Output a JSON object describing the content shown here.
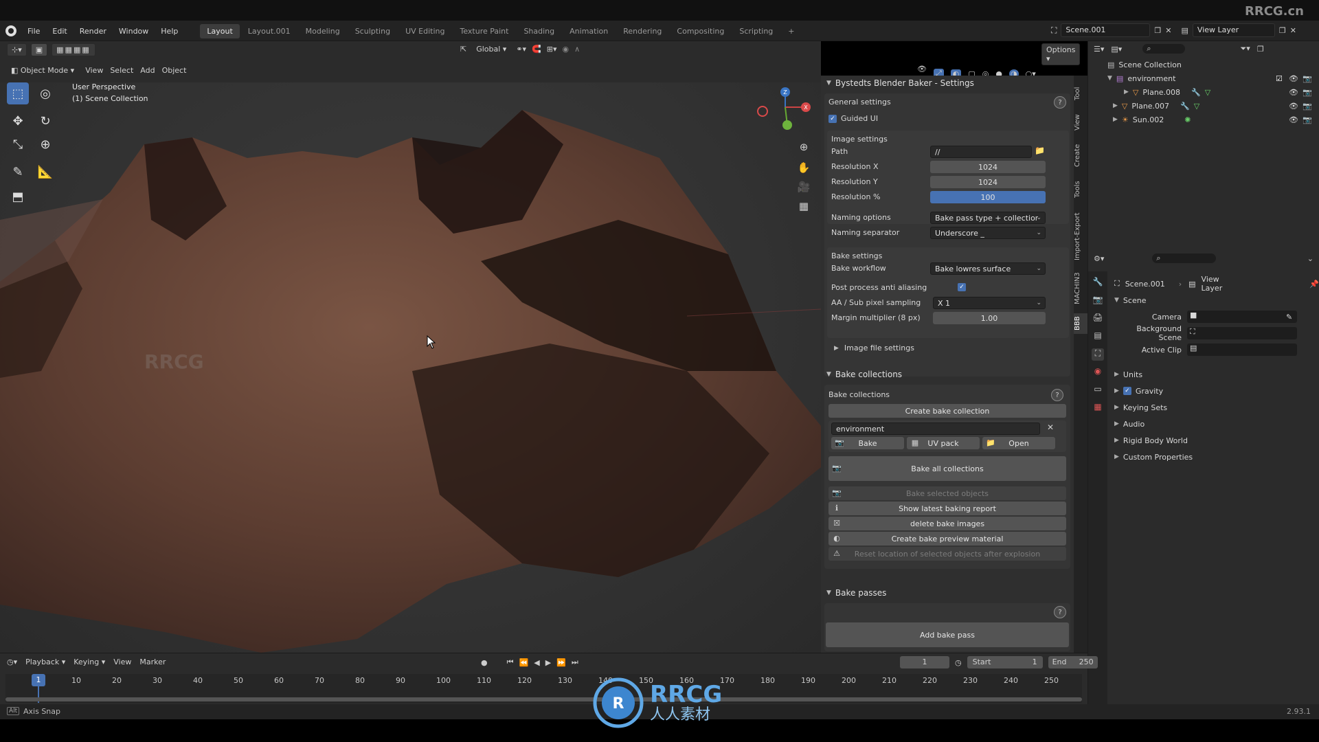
{
  "watermark": {
    "corner": "RRCG.cn",
    "center_title": "RRCG",
    "center_sub": "人人素材"
  },
  "menu": [
    "File",
    "Edit",
    "Render",
    "Window",
    "Help"
  ],
  "workspaces": [
    "Layout",
    "Layout.001",
    "Modeling",
    "Sculpting",
    "UV Editing",
    "Texture Paint",
    "Shading",
    "Animation",
    "Rendering",
    "Compositing",
    "Scripting"
  ],
  "workspace_add": "+",
  "scene_name": "Scene.001",
  "view_layer": "View Layer",
  "viewport_header": {
    "transform_orientation": "Global",
    "options": "Options",
    "mode": "Object Mode",
    "menus": [
      "View",
      "Select",
      "Add",
      "Object"
    ]
  },
  "viewport_overlay": {
    "perspective": "User Perspective",
    "collection": "(1) Scene Collection"
  },
  "side_tabs": [
    "Tool",
    "View",
    "Create",
    "Tools",
    "Import-Export",
    "MACHIN3",
    "BBB"
  ],
  "panel": {
    "title": "Bystedts Blender Baker - Settings",
    "general": "General settings",
    "guided_ui": "Guided UI",
    "image_settings": "Image settings",
    "path_label": "Path",
    "path_value": "//",
    "res_x_label": "Resolution X",
    "res_x": "1024",
    "res_y_label": "Resolution Y",
    "res_y": "1024",
    "res_pct_label": "Resolution %",
    "res_pct": "100",
    "naming_options_label": "Naming options",
    "naming_options": "Bake pass type + collection ...",
    "naming_sep_label": "Naming separator",
    "naming_sep": "Underscore _",
    "bake_settings": "Bake settings",
    "bake_workflow_label": "Bake workflow",
    "bake_workflow": "Bake lowres surface",
    "post_aa_label": "Post process anti aliasing",
    "aa_label": "AA / Sub pixel sampling",
    "aa_value": "X 1",
    "margin_label": "Margin multiplier (8 px)",
    "margin_value": "1.00",
    "image_file_settings": "Image file settings",
    "bake_collections_head": "Bake collections",
    "bake_collections_label": "Bake collections",
    "create_bake_collection": "Create bake collection",
    "collection_name": "environment",
    "bake": "Bake",
    "uv_pack": "UV pack",
    "open": "Open",
    "bake_all": "Bake all collections",
    "bake_selected": "Bake selected objects",
    "show_report": "Show latest baking report",
    "delete_images": "delete bake images",
    "preview_material": "Create bake preview material",
    "reset_location": "Reset location of selected objects after explosion",
    "bake_passes_head": "Bake passes",
    "add_bake_pass": "Add bake pass",
    "help": "?"
  },
  "outliner": {
    "root": "Scene Collection",
    "items": [
      {
        "name": "environment",
        "type": "collection"
      },
      {
        "name": "Plane.008",
        "type": "mesh"
      },
      {
        "name": "Plane.007",
        "type": "mesh"
      },
      {
        "name": "Sun.002",
        "type": "light"
      }
    ]
  },
  "properties": {
    "scene_name": "Scene.001",
    "view_layer": "View Layer",
    "section": "Scene",
    "camera_label": "Camera",
    "bg_label": "Background Scene",
    "clip_label": "Active Clip",
    "subpanels": [
      "Units",
      "Gravity",
      "Keying Sets",
      "Audio",
      "Rigid Body World",
      "Custom Properties"
    ]
  },
  "timeline": {
    "menus": [
      "Playback",
      "Keying",
      "View",
      "Marker"
    ],
    "current_frame": "1",
    "start_label": "Start",
    "start": "1",
    "end_label": "End",
    "end": "250",
    "ticks": [
      "10",
      "20",
      "30",
      "40",
      "50",
      "60",
      "70",
      "80",
      "90",
      "100",
      "110",
      "120",
      "130",
      "140",
      "150",
      "160",
      "170",
      "180",
      "190",
      "200",
      "210",
      "220",
      "230",
      "240",
      "250"
    ]
  },
  "status": {
    "left": "Axis Snap",
    "version": "2.93.1"
  },
  "colors": {
    "accent": "#4772b3",
    "terrain": "#6b4a3c",
    "panel": "#2f2f2f"
  }
}
